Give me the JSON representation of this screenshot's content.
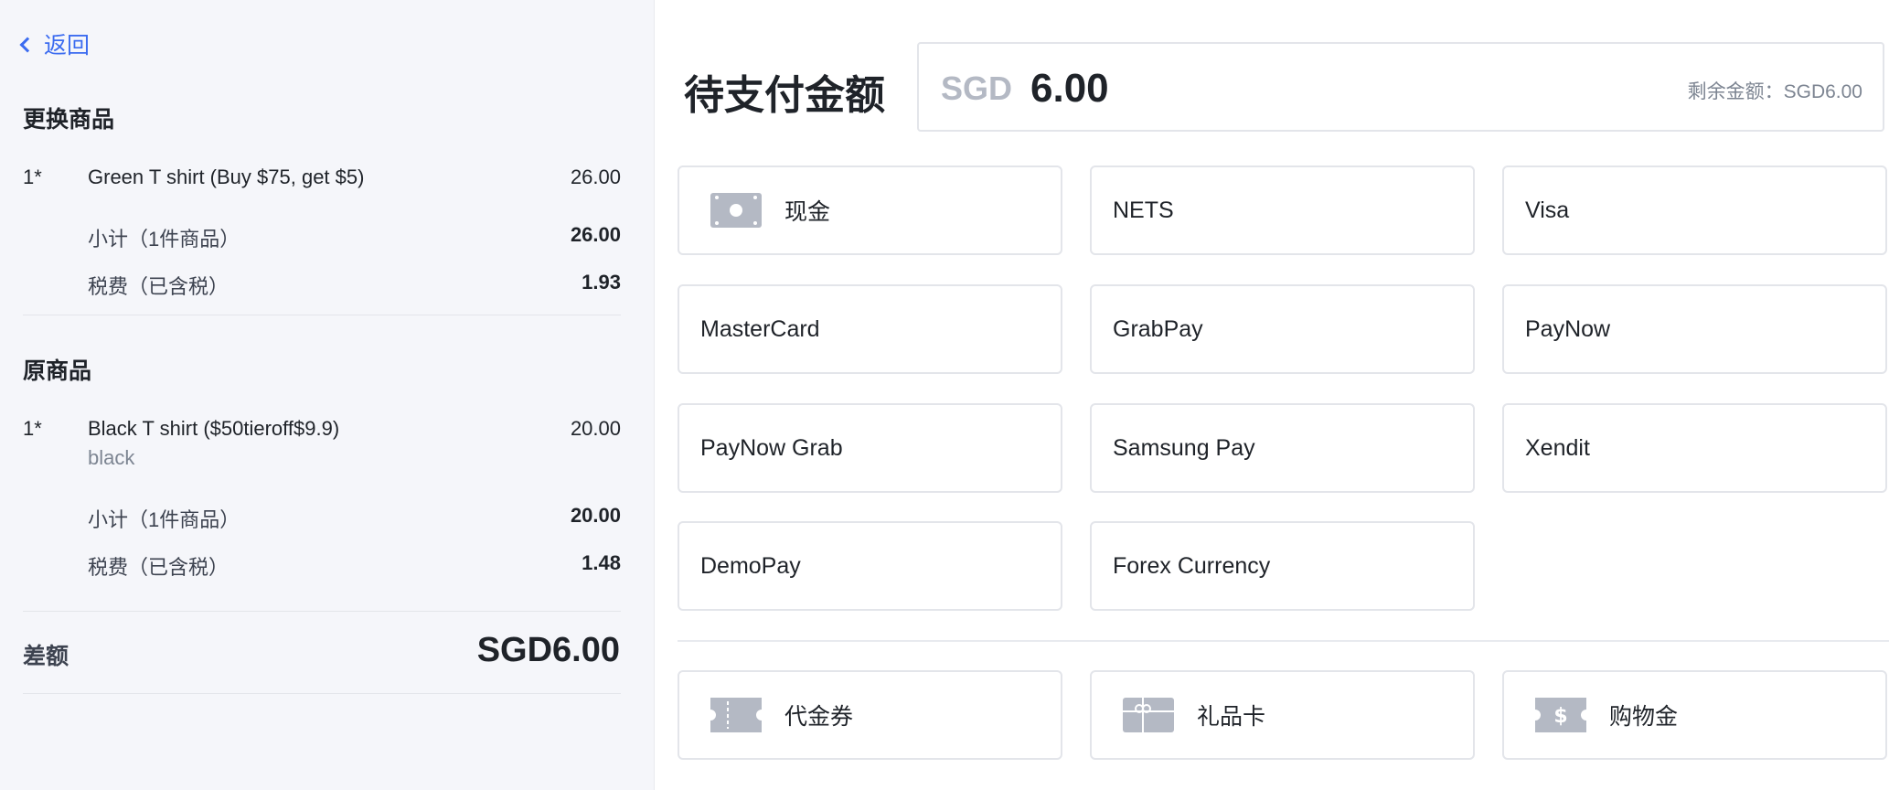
{
  "nav": {
    "back_label": "返回"
  },
  "exchange": {
    "title": "更换商品",
    "item": {
      "qty": "1*",
      "name": "Green T shirt (Buy $75, get $5)",
      "price": "26.00"
    },
    "subtotal_label": "小计（1件商品）",
    "subtotal": "26.00",
    "tax_label": "税费（已含税）",
    "tax": "1.93"
  },
  "original": {
    "title": "原商品",
    "item": {
      "qty": "1*",
      "name": "Black T shirt ($50tieroff$9.9)",
      "variant": "black",
      "price": "20.00"
    },
    "subtotal_label": "小计（1件商品）",
    "subtotal": "20.00",
    "tax_label": "税费（已含税）",
    "tax": "1.48"
  },
  "difference": {
    "label": "差额",
    "value": "SGD6.00"
  },
  "payment": {
    "title": "待支付金额",
    "currency": "SGD",
    "amount": "6.00",
    "remaining": "剩余金额：SGD6.00",
    "methods": [
      {
        "label": "现金",
        "icon": "cash-icon"
      },
      {
        "label": "NETS"
      },
      {
        "label": "Visa"
      },
      {
        "label": "MasterCard"
      },
      {
        "label": "GrabPay"
      },
      {
        "label": "PayNow"
      },
      {
        "label": "PayNow Grab"
      },
      {
        "label": "Samsung Pay"
      },
      {
        "label": "Xendit"
      },
      {
        "label": "DemoPay"
      },
      {
        "label": "Forex Currency"
      }
    ],
    "extras": [
      {
        "label": "代金券",
        "icon": "voucher-icon"
      },
      {
        "label": "礼品卡",
        "icon": "gift-card-icon"
      },
      {
        "label": "购物金",
        "icon": "store-credit-icon"
      }
    ]
  },
  "colors": {
    "accent": "#3c6cf0",
    "panel_bg": "#f5f6fa",
    "icon_gray": "#b4b9c4",
    "border": "#e3e5ea"
  }
}
